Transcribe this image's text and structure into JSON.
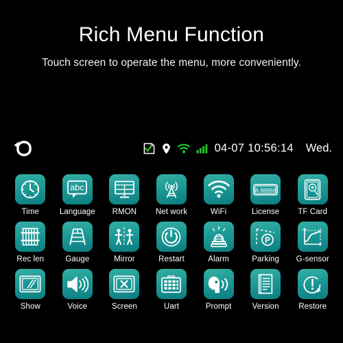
{
  "header": {
    "title": "Rich Menu Function",
    "subtitle": "Touch screen to operate the menu, more conveniently."
  },
  "statusbar": {
    "back_icon": "back-arrow-icon",
    "icons": [
      {
        "name": "sd-card-ok-icon",
        "color": "#22c32a"
      },
      {
        "name": "gps-pin-icon",
        "color": "#ffffff"
      },
      {
        "name": "wifi-icon",
        "color": "#22c32a"
      },
      {
        "name": "signal-bars-icon",
        "color": "#22c32a"
      }
    ],
    "datetime": "04-07 10:56:14",
    "weekday": "Wed."
  },
  "menu": {
    "items": [
      {
        "label": "Time",
        "icon": "clock-icon"
      },
      {
        "label": "Language",
        "icon": "abc-bubble-icon"
      },
      {
        "label": "RMON",
        "icon": "monitor-icon"
      },
      {
        "label": "Net work",
        "icon": "cell-tower-icon"
      },
      {
        "label": "WiFi",
        "icon": "wifi-icon"
      },
      {
        "label": "License",
        "icon": "license-plate-icon",
        "plate": "A 88888"
      },
      {
        "label": "TF Card",
        "icon": "tf-card-icon"
      },
      {
        "label": "Rec len",
        "icon": "film-strip-icon"
      },
      {
        "label": "Gauge",
        "icon": "ruler-gauge-icon"
      },
      {
        "label": "Mirror",
        "icon": "mirror-people-icon"
      },
      {
        "label": "Restart",
        "icon": "power-icon"
      },
      {
        "label": "Alarm",
        "icon": "siren-icon"
      },
      {
        "label": "Parking",
        "icon": "parking-p-icon"
      },
      {
        "label": "G-sensor",
        "icon": "gsensor-graph-icon"
      },
      {
        "label": "Show",
        "icon": "display-show-icon"
      },
      {
        "label": "Voice",
        "icon": "speaker-icon"
      },
      {
        "label": "Screen",
        "icon": "screen-off-icon"
      },
      {
        "label": "Uart",
        "icon": "keypad-icon"
      },
      {
        "label": "Prompt",
        "icon": "voice-prompt-icon"
      },
      {
        "label": "Version",
        "icon": "document-icon"
      },
      {
        "label": "Restore",
        "icon": "restore-warning-icon"
      }
    ]
  },
  "colors": {
    "background": "#000000",
    "tile_top": "#35b0a6",
    "tile_bottom": "#0c7d81",
    "status_green": "#22c32a",
    "text": "#ffffff"
  }
}
